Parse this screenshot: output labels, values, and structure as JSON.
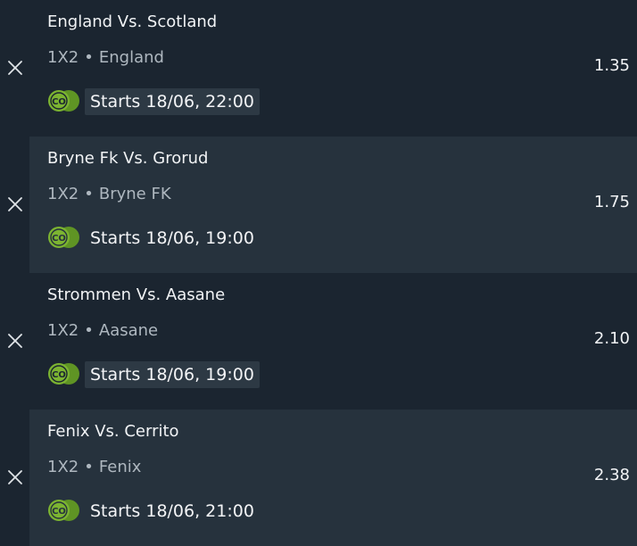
{
  "betslip": {
    "rows": [
      {
        "match": "England Vs. Scotland",
        "market": "1X2",
        "separator": "•",
        "selection": "England",
        "start": "Starts 18/06, 22:00",
        "odds": "1.35",
        "remove_icon": "close-icon",
        "sport_icon": "co-coin-icon"
      },
      {
        "match": "Bryne Fk Vs. Grorud",
        "market": "1X2",
        "separator": "•",
        "selection": "Bryne FK",
        "start": "Starts 18/06, 19:00",
        "odds": "1.75",
        "remove_icon": "close-icon",
        "sport_icon": "co-coin-icon"
      },
      {
        "match": "Strommen Vs. Aasane",
        "market": "1X2",
        "separator": "•",
        "selection": "Aasane",
        "start": "Starts 18/06, 19:00",
        "odds": "2.10",
        "remove_icon": "close-icon",
        "sport_icon": "co-coin-icon"
      },
      {
        "match": "Fenix Vs. Cerrito",
        "market": "1X2",
        "separator": "•",
        "selection": "Fenix",
        "start": "Starts 18/06, 21:00",
        "odds": "2.38",
        "remove_icon": "close-icon",
        "sport_icon": "co-coin-icon"
      }
    ],
    "coin_label": "CO"
  },
  "colors": {
    "background": "#1b2530",
    "row_alt": "#26323d",
    "coin_green": "#7cb431",
    "text_primary": "#f1f3f5",
    "text_secondary": "#aeb7bf"
  }
}
